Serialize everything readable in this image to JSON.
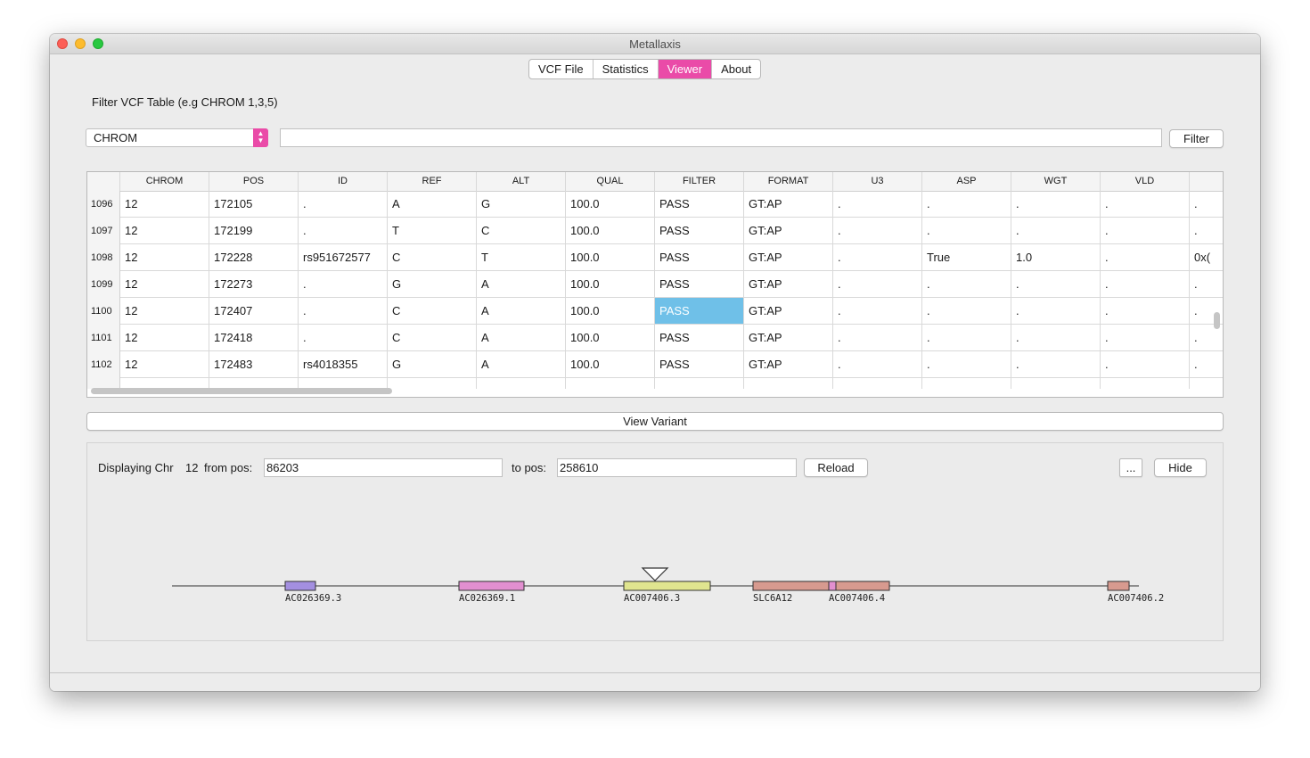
{
  "window": {
    "title": "Metallaxis"
  },
  "tabs": [
    {
      "label": "VCF File",
      "active": false
    },
    {
      "label": "Statistics",
      "active": false
    },
    {
      "label": "Viewer",
      "active": true
    },
    {
      "label": "About",
      "active": false
    }
  ],
  "filter": {
    "label": "Filter VCF Table (e.g CHROM 1,3,5)",
    "column_select": "CHROM",
    "input_value": "",
    "button": "Filter"
  },
  "table": {
    "columns": [
      "CHROM",
      "POS",
      "ID",
      "REF",
      "ALT",
      "QUAL",
      "FILTER",
      "FORMAT",
      "U3",
      "ASP",
      "WGT",
      "VLD",
      ""
    ],
    "rows": [
      {
        "index": "1096",
        "cells": [
          "12",
          "172105",
          ".",
          "A",
          "G",
          "100.0",
          "PASS",
          "GT:AP",
          ".",
          ".",
          ".",
          ".",
          "."
        ]
      },
      {
        "index": "1097",
        "cells": [
          "12",
          "172199",
          ".",
          "T",
          "C",
          "100.0",
          "PASS",
          "GT:AP",
          ".",
          ".",
          ".",
          ".",
          "."
        ]
      },
      {
        "index": "1098",
        "cells": [
          "12",
          "172228",
          "rs951672577",
          "C",
          "T",
          "100.0",
          "PASS",
          "GT:AP",
          ".",
          "True",
          "1.0",
          ".",
          "0x("
        ]
      },
      {
        "index": "1099",
        "cells": [
          "12",
          "172273",
          ".",
          "G",
          "A",
          "100.0",
          "PASS",
          "GT:AP",
          ".",
          ".",
          ".",
          ".",
          "."
        ]
      },
      {
        "index": "1100",
        "cells": [
          "12",
          "172407",
          ".",
          "C",
          "A",
          "100.0",
          "PASS",
          "GT:AP",
          ".",
          ".",
          ".",
          ".",
          "."
        ]
      },
      {
        "index": "1101",
        "cells": [
          "12",
          "172418",
          ".",
          "C",
          "A",
          "100.0",
          "PASS",
          "GT:AP",
          ".",
          ".",
          ".",
          ".",
          "."
        ]
      },
      {
        "index": "1102",
        "cells": [
          "12",
          "172483",
          "rs4018355",
          "G",
          "A",
          "100.0",
          "PASS",
          "GT:AP",
          ".",
          ".",
          ".",
          ".",
          "."
        ]
      }
    ],
    "selected_cell": {
      "row": 4,
      "col": 6
    }
  },
  "view_variant_button": "View Variant",
  "viewer": {
    "displaying_label": "Displaying Chr",
    "chr": "12",
    "from_label": "from pos:",
    "from_value": "86203",
    "to_label": "to pos:",
    "to_value": "258610",
    "reload_button": "Reload",
    "more_button": "...",
    "hide_button": "Hide",
    "genes": [
      {
        "name": "AC026369.3",
        "color": "#a38fe0"
      },
      {
        "name": "AC026369.1",
        "color": "#e28fd0"
      },
      {
        "name": "AC007406.3",
        "color": "#e0e58f"
      },
      {
        "name": "SLC6A12",
        "color": "#d79a8f"
      },
      {
        "name": "AC007406.4",
        "color": "#d79a8f"
      },
      {
        "name": "AC007406.2",
        "color": "#d79a8f"
      }
    ]
  },
  "colors": {
    "accent": "#ea4ba8",
    "selection": "#6fc0e8"
  }
}
